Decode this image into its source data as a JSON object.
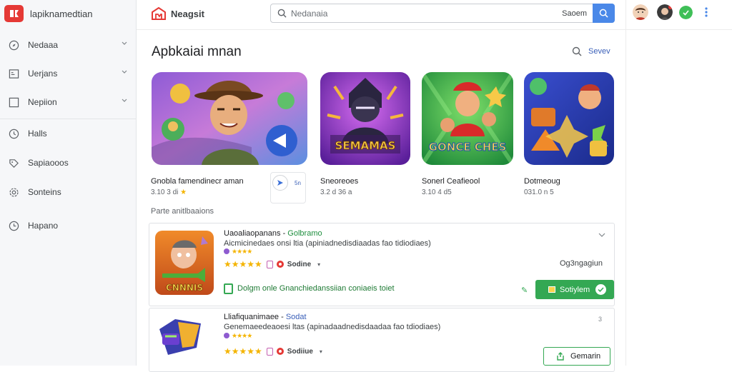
{
  "app": {
    "brand_name": "lapiknamedtian",
    "site_name": "Neagsit"
  },
  "search": {
    "placeholder": "Nedanaia",
    "button_label": "Saoem"
  },
  "sidebar": {
    "items": [
      {
        "label": "Nedaaa",
        "icon": "compass-icon"
      },
      {
        "label": "Uerjans",
        "icon": "grid-icon"
      },
      {
        "label": "Nepiion",
        "icon": "square-icon"
      },
      {
        "label": "Halls",
        "icon": "clock-icon"
      },
      {
        "label": "Sapiaooos",
        "icon": "tag-icon"
      },
      {
        "label": "Sonteins",
        "icon": "gear-icon"
      },
      {
        "label": "Hapano",
        "icon": "history-icon"
      }
    ]
  },
  "main": {
    "title": "Apbkaiai mnan",
    "see_all": "Sevev",
    "featured": [
      {
        "title": "Gnobla famendinecr aman",
        "meta": "3.10 3 di",
        "star": "★",
        "chip_label": "5n"
      },
      {
        "title": "Sneoreoes",
        "meta": "3.2 d 36 a",
        "art_text": "SEMAMAS"
      },
      {
        "title": "Sonerl Ceafieool",
        "meta": "3.10 4 d5",
        "art_text": "GONCE CHES"
      },
      {
        "title": "Dotmeoug",
        "meta": "031.0 n 5"
      }
    ],
    "section_label": "Parte anitlbaaions",
    "list": [
      {
        "title": "Uaoaliaopanans",
        "developer": "Golbramo",
        "description": "Aicmicinedaes onsi ltia (apiniadnedisdiaadas fao tidiodiaes)",
        "source": "Sodine",
        "right_text": "Og3ngagiun",
        "art_text": "CNNNIS"
      },
      {
        "title": "Lliafiquanimaee",
        "developer": "Sodat",
        "description": "Genemaeedeaoesi ltas (apinadaadnedisdaadaa fao tdiodiaes)",
        "source": "Sodiiue",
        "right_text": "3"
      }
    ],
    "promo": {
      "text": "Dolgm onle Gnanchiedanssiian coniaeis toiet",
      "install_label": "Sotiylem"
    },
    "second_install_label": "Gemarin"
  },
  "colors": {
    "accent_blue": "#4a88e8",
    "install_green": "#34a853",
    "brand_red": "#e53935",
    "star": "#f4b400"
  }
}
